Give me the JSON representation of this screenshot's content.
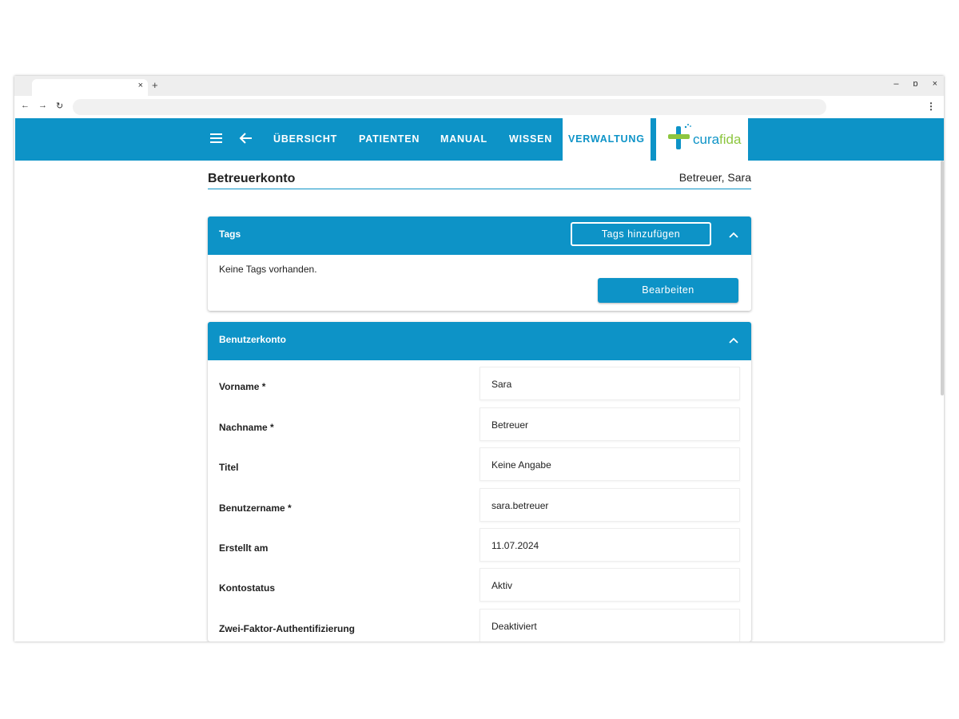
{
  "browser": {
    "tab_close": "×",
    "new_tab": "+",
    "minimize": "–",
    "restore": "ɒ",
    "close": "×",
    "back": "←",
    "forward": "→",
    "reload": "↻",
    "menu": "⋮"
  },
  "nav": {
    "items": [
      {
        "label": "ÜBERSICHT"
      },
      {
        "label": "PATIENTEN"
      },
      {
        "label": "MANUAL"
      },
      {
        "label": "WISSEN"
      },
      {
        "label": "VERWALTUNG",
        "active": true
      }
    ],
    "logo_text_a": "cura",
    "logo_text_b": "fida",
    "accent_color": "#0d93c7"
  },
  "page": {
    "title": "Betreuerkonto",
    "user": "Betreuer, Sara"
  },
  "tags_panel": {
    "title": "Tags",
    "add_button": "Tags hinzufügen",
    "empty_text": "Keine Tags vorhanden.",
    "edit_button": "Bearbeiten"
  },
  "account_panel": {
    "title": "Benutzerkonto",
    "rows": [
      {
        "label": "Vorname *",
        "value": "Sara"
      },
      {
        "label": "Nachname *",
        "value": "Betreuer"
      },
      {
        "label": "Titel",
        "value": "Keine Angabe"
      },
      {
        "label": "Benutzername *",
        "value": "sara.betreuer"
      },
      {
        "label": "Erstellt am",
        "value": "11.07.2024"
      },
      {
        "label": "Kontostatus",
        "value": "Aktiv"
      },
      {
        "label": "Zwei-Faktor-Authentifizierung",
        "value": "Deaktiviert"
      }
    ]
  }
}
